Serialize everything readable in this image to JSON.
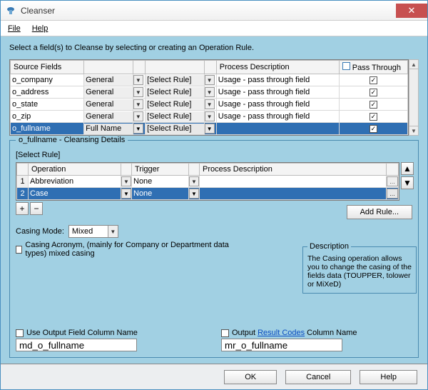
{
  "window": {
    "title": "Cleanser"
  },
  "menu": {
    "file": "File",
    "help": "Help"
  },
  "instruction": "Select a field(s) to Cleanse by selecting or creating an Operation Rule.",
  "sourceGrid": {
    "headers": {
      "field": "Source Fields",
      "process": "Process Description",
      "pass": "Pass Through"
    },
    "selectRule": "[Select Rule]",
    "general": "General",
    "fullname": "Full Name",
    "rows": [
      {
        "field": "o_company",
        "type": "General",
        "process": "Usage - pass through field",
        "pass": true,
        "selected": false
      },
      {
        "field": "o_address",
        "type": "General",
        "process": "Usage - pass through field",
        "pass": true,
        "selected": false
      },
      {
        "field": "o_state",
        "type": "General",
        "process": "Usage - pass through field",
        "pass": true,
        "selected": false
      },
      {
        "field": "o_zip",
        "type": "General",
        "process": "Usage - pass through field",
        "pass": true,
        "selected": false
      },
      {
        "field": "o_fullname",
        "type": "Full Name",
        "process": "",
        "pass": true,
        "selected": true
      }
    ]
  },
  "details": {
    "legend": "o_fullname - Cleansing Details",
    "selectRule": "[Select Rule]",
    "headers": {
      "op": "Operation",
      "trigger": "Trigger",
      "process": "Process Description"
    },
    "rows": [
      {
        "n": "1",
        "op": "Abbreviation",
        "trigger": "None",
        "process": "",
        "selected": false
      },
      {
        "n": "2",
        "op": "Case",
        "trigger": "None",
        "process": "",
        "selected": true
      }
    ],
    "addRule": "Add Rule...",
    "casingModeLabel": "Casing Mode:",
    "casingModeValue": "Mixed",
    "acronymLabel": "Casing Acronym, (mainly for Company or Department data types) mixed casing",
    "descLegend": "Description",
    "descText": "The Casing operation allows you to change the casing of the fields data (TOUPPER, tolower or MiXeD)"
  },
  "output": {
    "useLabel": "Use Output Field Column Name",
    "useValue": "md_o_fullname",
    "outLabelPre": "Output ",
    "outLabelLink": "Result Codes",
    "outLabelPost": " Column Name",
    "outValue": "mr_o_fullname"
  },
  "footer": {
    "ok": "OK",
    "cancel": "Cancel",
    "help": "Help"
  }
}
